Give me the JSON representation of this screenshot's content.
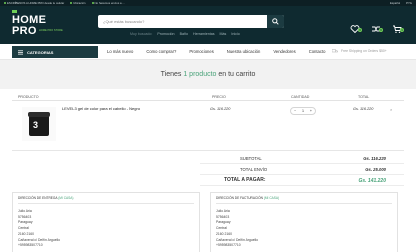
{
  "topbar": {
    "left": [
      "ESCRÍBENOS A HOME PRO desde tu celular",
      "Ubicación",
      "No hacemos envíos a ..."
    ],
    "right": [
      "Español",
      "PYG"
    ]
  },
  "header": {
    "logo_top": "HOME",
    "logo_bottom": "PRO",
    "logo_sub": "HOME PRO STORE",
    "search_placeholder": "¿Qué estás buscando?",
    "tags_label": "Muy buscado:",
    "tags": [
      "Promoción",
      "Baño",
      "Herramientas",
      "Más",
      "Inicio"
    ],
    "wishlist_count": "0",
    "compare_count": "0",
    "cart_count": "1"
  },
  "nav": {
    "categories": "CATEGORIAS",
    "links": [
      "Lo más nuevo",
      "Como comprar?",
      "Promociones",
      "Nuestra ubicación",
      "Vendedores",
      "Contacto"
    ],
    "shipping": "Free Shipping on Orders $50+"
  },
  "cart": {
    "title_prefix": "Tienes ",
    "title_highlight": "1 producto",
    "title_suffix": " en tu carrito",
    "columns": {
      "product": "PRODUCTO",
      "price": "PRECIO",
      "quantity": "CANTIDAD",
      "total": "TOTAL"
    },
    "item": {
      "name": "LEVEL3 gel de color para el cabello - Negro",
      "image_label": "3",
      "price": "Gs. 116.220",
      "quantity": "1",
      "total": "Gs. 116.220",
      "remove": "×"
    },
    "summary": {
      "subtotal_label": "SUBTOTAL",
      "subtotal": "Gs. 116.220",
      "shipping_label": "TOTAL ENVÍO",
      "shipping": "Gs. 25.000",
      "grand_label": "TOTAL A PAGAR:",
      "grand": "Gs. 141.220"
    }
  },
  "addresses": {
    "delivery": {
      "head": "DIRECCIÓN DE ENTREGA",
      "tag": "(MI CASA)",
      "lines": [
        "Julio Aria",
        "5756403",
        "Paraguay",
        "Central",
        "2160 2160",
        "Cañaveral c/ Delfín Arguello",
        "+595983507710"
      ]
    },
    "billing": {
      "head": "DIRECCIÓN DE FACTURACIÓN",
      "tag": "(MI CASA)",
      "lines": [
        "Julio Aria",
        "5756403",
        "Paraguay",
        "Central",
        "2160 2160",
        "Cañaveral c/ Delfín Arguello",
        "+595983507710"
      ]
    }
  },
  "colors": {
    "dark": "#0f2a30",
    "accent": "#6fcf57",
    "green_text": "#4aa37a"
  }
}
